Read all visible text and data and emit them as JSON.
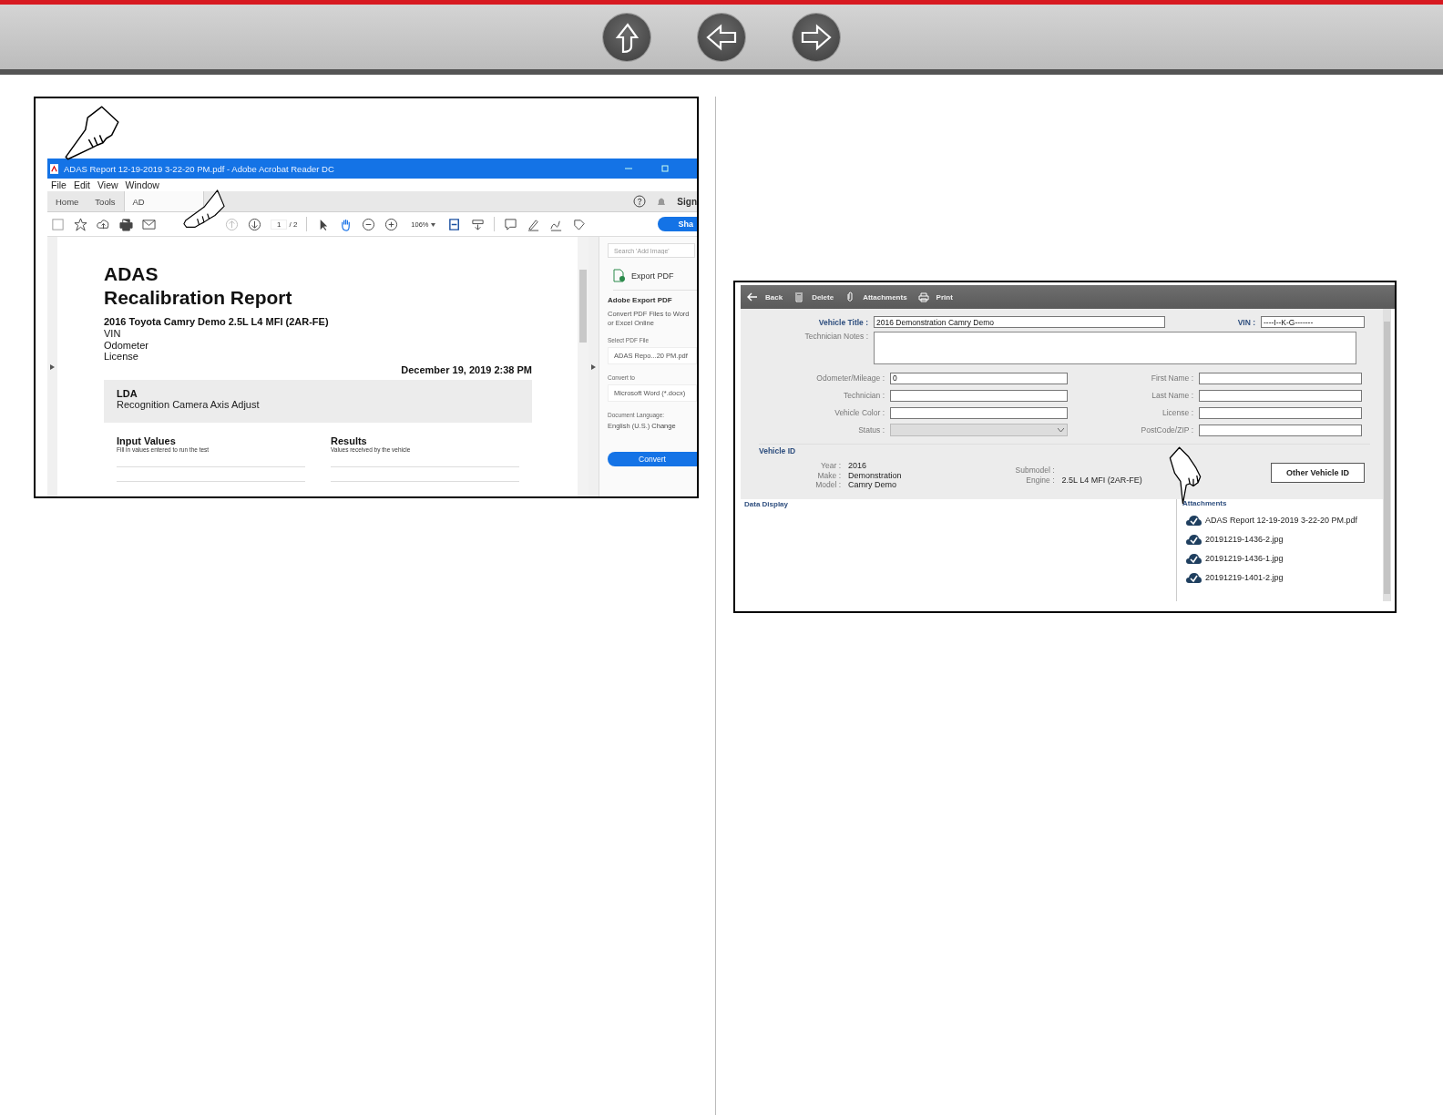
{
  "acrobat": {
    "title": "ADAS Report 12-19-2019 3-22-20 PM.pdf - Adobe Acrobat Reader DC",
    "menu": [
      "File",
      "Edit",
      "View",
      "Window"
    ],
    "tabs": [
      {
        "label": "Home",
        "selected": false
      },
      {
        "label": "Tools",
        "selected": false
      },
      {
        "label": "AD",
        "selected": true
      }
    ],
    "sign_label": "Sign",
    "share_label": "Sha",
    "page_current": "1",
    "page_total": "/ 2",
    "zoom": "106%",
    "document": {
      "heading_1": "ADAS",
      "heading_2": "Recalibration Report",
      "vehicle": "2016 Toyota Camry Demo 2.5L L4 MFI (2AR-FE)",
      "fields": [
        "VIN",
        "Odometer",
        "License"
      ],
      "date": "December 19, 2019 2:38 PM",
      "section_code": "LDA",
      "section_name": "Recognition Camera Axis Adjust",
      "columns": [
        {
          "title": "Input Values",
          "subtitle": "Fill in values entered to run the test"
        },
        {
          "title": "Results",
          "subtitle": "Values received by the vehicle"
        }
      ]
    },
    "side_panel": {
      "search_placeholder": "Search 'Add Image'",
      "export_label": "Export PDF",
      "heading": "Adobe Export PDF",
      "description": "Convert PDF Files to Word or Excel Online",
      "select_label": "Select PDF File",
      "file": "ADAS Repo...20 PM.pdf",
      "convert_label": "Convert to",
      "format": "Microsoft Word (*.docx)",
      "language_label": "Document Language:",
      "language": "English (U.S.)",
      "change_link": "Change",
      "convert_button": "Convert"
    }
  },
  "vehicle_app": {
    "toolbar": [
      {
        "kind": "back",
        "label": "Back"
      },
      {
        "kind": "delete",
        "label": "Delete"
      },
      {
        "kind": "attach",
        "label": "Attachments"
      },
      {
        "kind": "print",
        "label": "Print"
      }
    ],
    "vehicle_title": {
      "label": "Vehicle Title :",
      "value": "2016 Demonstration Camry Demo"
    },
    "vin": {
      "label": "VIN :",
      "value": "----I--K-G-------"
    },
    "notes_label": "Technician Notes :",
    "left_fields": [
      {
        "kind": "text",
        "label": "Odometer/Mileage :",
        "value": "0"
      },
      {
        "kind": "text",
        "label": "Technician :"
      },
      {
        "kind": "text",
        "label": "Vehicle Color :"
      },
      {
        "kind": "select",
        "label": "Status :"
      }
    ],
    "right_fields": [
      {
        "label": "First Name :"
      },
      {
        "label": "Last Name :"
      },
      {
        "label": "License :"
      },
      {
        "label": "PostCode/ZIP :"
      }
    ],
    "vehicle_id": {
      "title": "Vehicle ID",
      "left": [
        {
          "label": "Year :",
          "value": "2016"
        },
        {
          "label": "Make :",
          "value": "Demonstration"
        },
        {
          "label": "Model :",
          "value": "Camry Demo"
        }
      ],
      "right": [
        {
          "label": "Submodel :"
        },
        {
          "label": "Engine :",
          "value": "2.5L L4 MFI (2AR-FE)"
        }
      ],
      "button": "Other Vehicle ID"
    },
    "data_display_title": "Data Display",
    "attachments_title": "Attachments",
    "attachments": [
      "ADAS Report 12-19-2019 3-22-20 PM.pdf",
      "20191219-1436-2.jpg",
      "20191219-1436-1.jpg",
      "20191219-1401-2.jpg"
    ]
  }
}
